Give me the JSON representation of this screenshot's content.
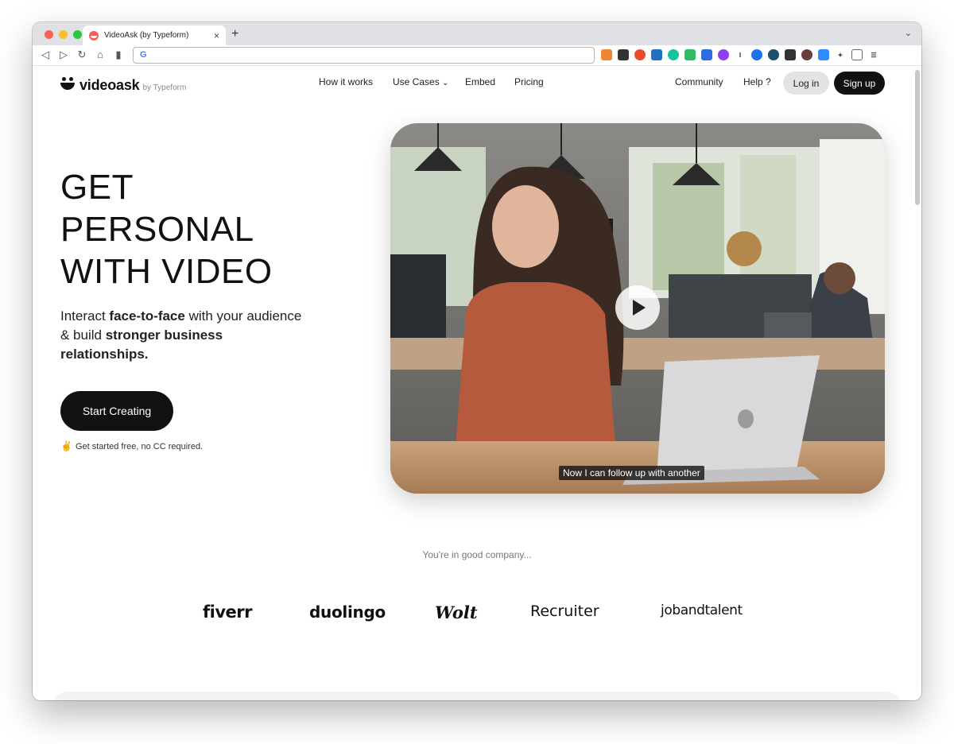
{
  "browser": {
    "tab_title": "VideoAsk (by Typeform)",
    "new_tab": "+",
    "omnibox_placeholder": "",
    "omnibox_g": "G"
  },
  "site": {
    "logo_word": "videoask",
    "logo_by": "by Typeform",
    "nav": [
      "How it works",
      "Use Cases",
      "Embed",
      "Pricing",
      "Community",
      "Help ?"
    ],
    "login": "Log in",
    "signup": "Sign up"
  },
  "hero": {
    "title_lines": [
      "GET",
      "PERSONAL",
      "WITH VIDEO"
    ],
    "sub_1": "Interact ",
    "sub_2": "face-to-face",
    "sub_3": " with your audience & build ",
    "sub_4": "stronger business relationships.",
    "cta": "Start Creating",
    "note": "Get started free, no CC required."
  },
  "video": {
    "caption": "Now I can follow up with another"
  },
  "social_proof": {
    "heading": "You're in good company...",
    "brands": [
      "fiverr",
      "duolingo",
      "Wolt",
      "Recruiter",
      "jobandtalent"
    ]
  },
  "colors": {
    "accent": "#111111",
    "brand_red": "#f25f5c"
  }
}
